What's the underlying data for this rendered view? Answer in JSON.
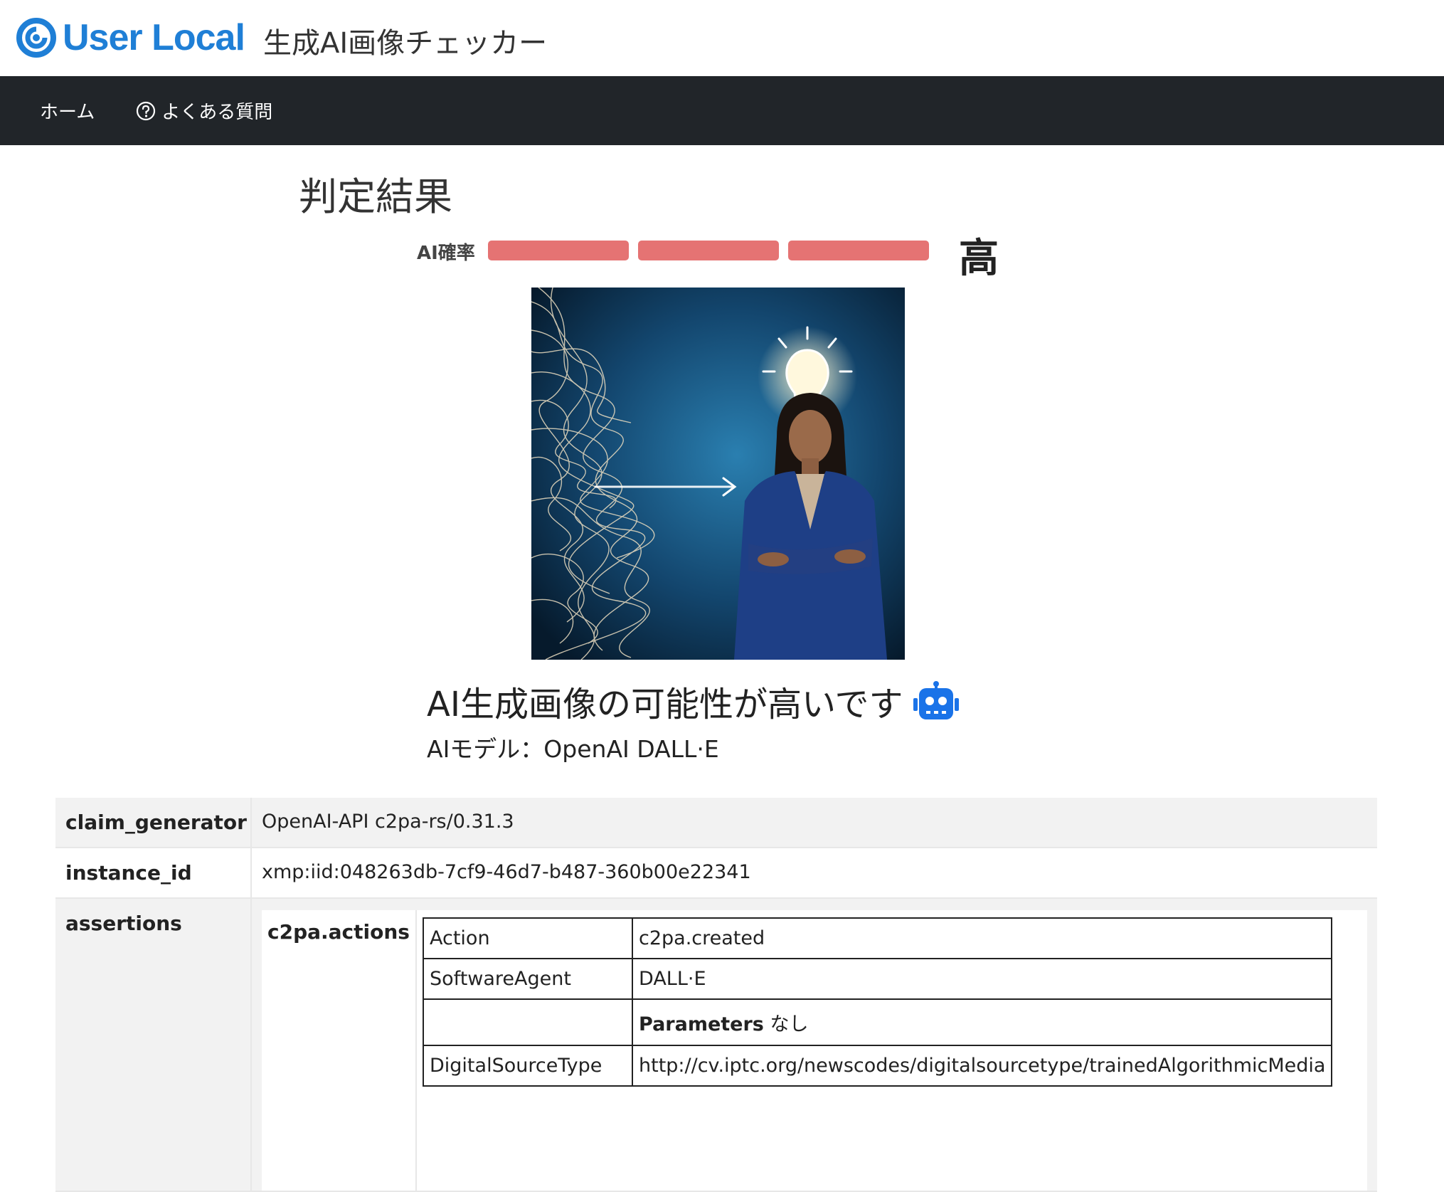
{
  "header": {
    "logo_text": "User Local",
    "app_title": "生成AI画像チェッカー"
  },
  "nav": {
    "home": "ホーム",
    "faq": "よくある質問"
  },
  "result": {
    "title": "判定結果",
    "prob_label": "AI確率",
    "prob_level": "高",
    "prob_filled_segments": 3,
    "prob_total_segments": 3,
    "bar_color": "#e57373",
    "verdict": "AI生成画像の可能性が高いです",
    "model_line": "AIモデル：OpenAI DALL·E"
  },
  "metadata": {
    "rows": [
      {
        "key": "claim_generator",
        "value": "OpenAI-API c2pa-rs/0.31.3"
      },
      {
        "key": "instance_id",
        "value": "xmp:iid:048263db-7cf9-46d7-b487-360b00e22341"
      },
      {
        "key": "assertions",
        "value": ""
      }
    ],
    "assertion_key": "c2pa.actions",
    "actions": [
      {
        "key": "Action",
        "value": "c2pa.created"
      },
      {
        "key": "SoftwareAgent",
        "value": "DALL·E"
      },
      {
        "key": "",
        "value_bold": "Parameters",
        "value": " なし"
      },
      {
        "key": "DigitalSourceType",
        "value": "http://cv.iptc.org/newscodes/digitalsourcetype/trainedAlgorithmicMedia"
      }
    ]
  },
  "colors": {
    "brand": "#1f7fd6",
    "navbar": "#212529",
    "robot": "#1a73e8"
  }
}
